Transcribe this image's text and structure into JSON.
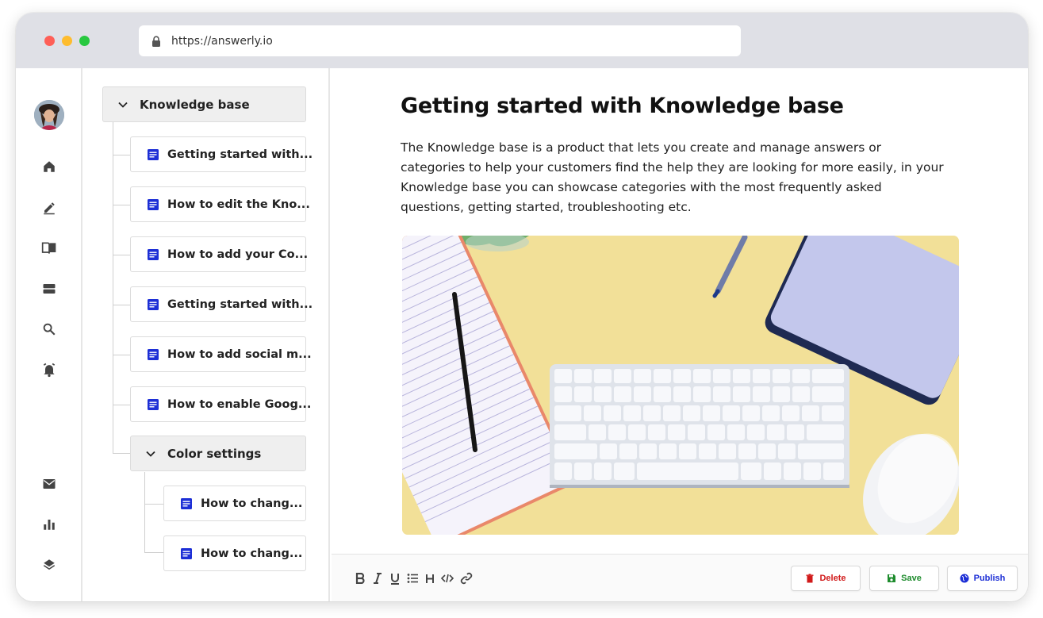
{
  "browser": {
    "url": "https://answerly.io"
  },
  "rail": {
    "icons": [
      "home-icon",
      "edit-icon",
      "book-icon",
      "storage-icon",
      "search-icon",
      "alarm-icon",
      "mail-icon",
      "bar-chart-icon",
      "layers-icon"
    ]
  },
  "tree": {
    "root": {
      "label": "Knowledge base"
    },
    "items": [
      {
        "label": "Getting started with..."
      },
      {
        "label": "How to edit the Kno..."
      },
      {
        "label": "How to add your Co..."
      },
      {
        "label": "Getting started with..."
      },
      {
        "label": "How to add social m..."
      },
      {
        "label": "How to enable Goog..."
      }
    ],
    "subfolder": {
      "label": "Color settings"
    },
    "subitems": [
      {
        "label": "How to chang..."
      },
      {
        "label": "How to chang..."
      }
    ]
  },
  "article": {
    "title": "Getting started with Knowledge base",
    "body": "The Knowledge base is a product that lets you create and manage answers or categories to help your customers find the help they are looking for more easily, in your Knowledge base you can showcase categories with the most frequently asked questions, getting started, troubleshooting etc."
  },
  "toolbar": {
    "delete_label": "Delete",
    "save_label": "Save",
    "publish_label": "Publish"
  },
  "colors": {
    "accent": "#1d2fd6",
    "delete": "#d11a1a",
    "save": "#1e8c2d",
    "publish": "#1d2fd6"
  }
}
